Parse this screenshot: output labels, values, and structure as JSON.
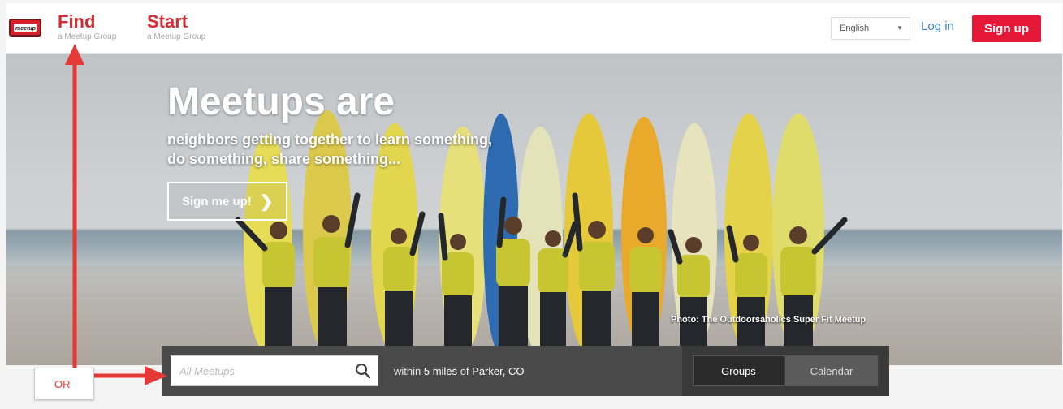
{
  "header": {
    "logo_text": "meetup",
    "find": {
      "label": "Find",
      "sub": "a Meetup Group"
    },
    "start": {
      "label": "Start",
      "sub": "a Meetup Group"
    },
    "language": "English",
    "login": "Log in",
    "signup": "Sign up"
  },
  "hero": {
    "title": "Meetups are",
    "subtitle_line1": "neighbors getting together to learn something,",
    "subtitle_line2": "do something, share something...",
    "cta": "Sign me up!",
    "photo_credit": "Photo: The Outdoorsaholics Super Fit Meetup"
  },
  "search": {
    "placeholder": "All Meetups",
    "within": "within",
    "radius": "5 miles",
    "of": "of",
    "location": "Parker, CO",
    "view_groups": "Groups",
    "view_calendar": "Calendar"
  },
  "annotation": {
    "or_label": "OR",
    "color": "#e53935"
  },
  "colors": {
    "brand_red": "#e51937",
    "link_blue": "#3f82c6",
    "strip_dark": "#4a4a4a"
  }
}
